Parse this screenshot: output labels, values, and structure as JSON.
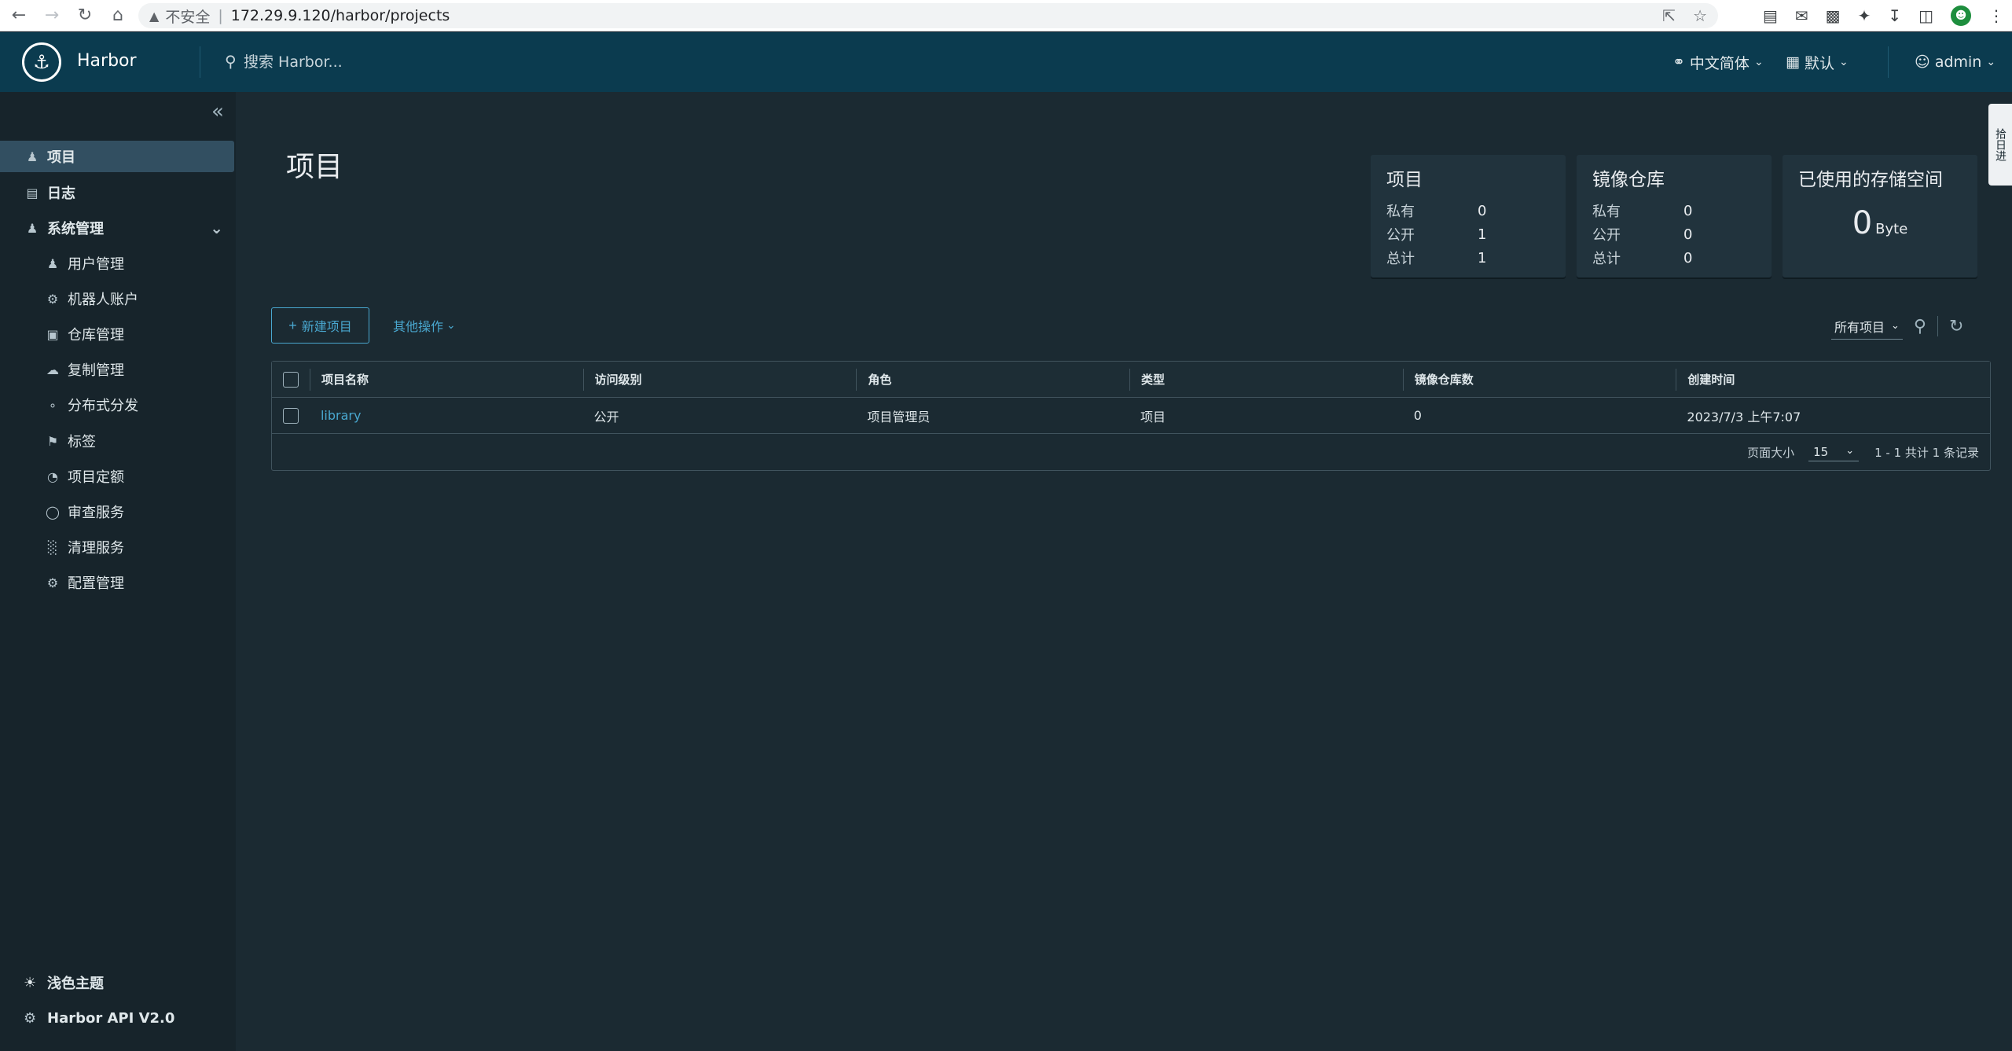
{
  "browser": {
    "insecure_label": "不安全",
    "url": "172.29.9.120/harbor/projects"
  },
  "header": {
    "brand": "Harbor",
    "search_placeholder": "搜索 Harbor...",
    "language": "中文简体",
    "datetime_format": "默认",
    "user": "admin"
  },
  "sidebar": {
    "items": [
      {
        "label": "项目"
      },
      {
        "label": "日志"
      },
      {
        "label": "系统管理"
      }
    ],
    "sub_items": [
      {
        "label": "用户管理"
      },
      {
        "label": "机器人账户"
      },
      {
        "label": "仓库管理"
      },
      {
        "label": "复制管理"
      },
      {
        "label": "分布式分发"
      },
      {
        "label": "标签"
      },
      {
        "label": "项目定额"
      },
      {
        "label": "审查服务"
      },
      {
        "label": "清理服务"
      },
      {
        "label": "配置管理"
      }
    ],
    "theme_toggle": "浅色主题",
    "api": "Harbor API V2.0"
  },
  "main": {
    "title": "项目",
    "stats": {
      "projects": {
        "title": "项目",
        "private_label": "私有",
        "private": "0",
        "public_label": "公开",
        "public": "1",
        "total_label": "总计",
        "total": "1"
      },
      "repos": {
        "title": "镜像仓库",
        "private_label": "私有",
        "private": "0",
        "public_label": "公开",
        "public": "0",
        "total_label": "总计",
        "total": "0"
      },
      "storage": {
        "title": "已使用的存储空间",
        "value": "0",
        "unit": "Byte"
      }
    },
    "new_project": "新建项目",
    "more_actions": "其他操作",
    "filter_all": "所有项目",
    "columns": [
      "项目名称",
      "访问级别",
      "角色",
      "类型",
      "镜像仓库数",
      "创建时间"
    ],
    "rows": [
      {
        "name": "library",
        "access": "公开",
        "role": "项目管理员",
        "type": "项目",
        "repo_count": "0",
        "created": "2023/7/3 上午7:07"
      }
    ],
    "page_size_label": "页面大小",
    "page_size": "15",
    "pagination": "1 - 1 共计 1 条记录"
  },
  "side_tab": "拾日进"
}
